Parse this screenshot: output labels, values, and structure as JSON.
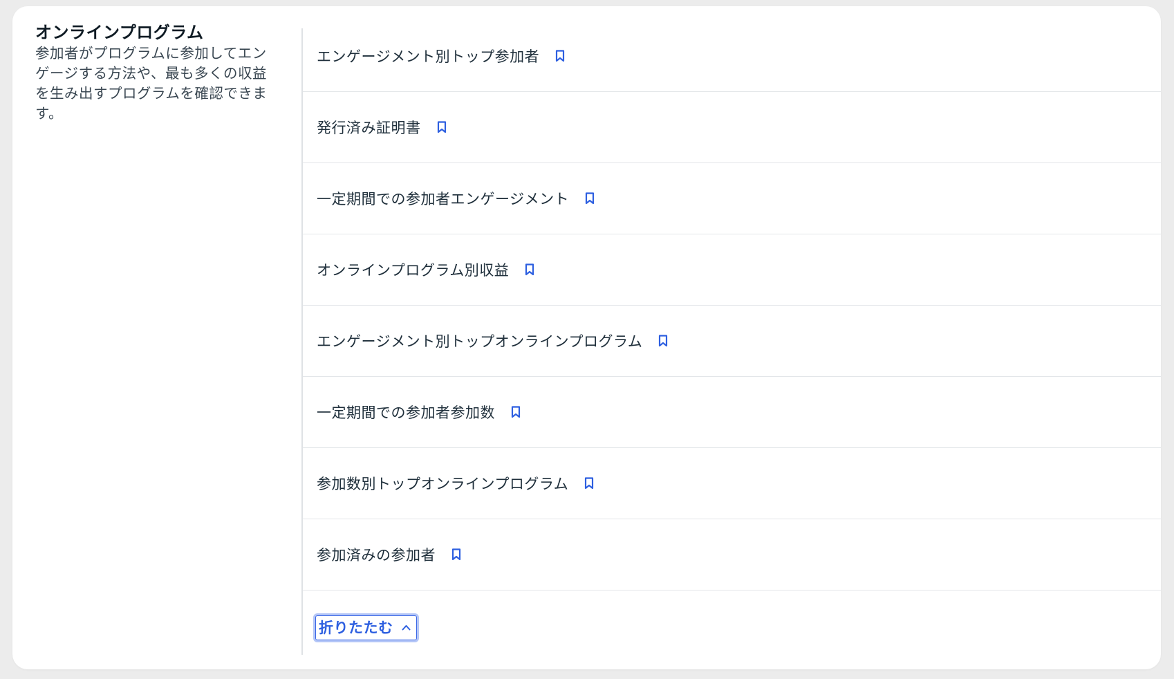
{
  "section": {
    "title": "オンラインプログラム",
    "description": "参加者がプログラムに参加してエンゲージする方法や、最も多くの収益を生み出すプログラムを確認できます。"
  },
  "reports": [
    {
      "label": "エンゲージメント別トップ参加者"
    },
    {
      "label": "発行済み証明書"
    },
    {
      "label": "一定期間での参加者エンゲージメント"
    },
    {
      "label": "オンラインプログラム別収益"
    },
    {
      "label": "エンゲージメント別トップオンラインプログラム"
    },
    {
      "label": "一定期間での参加者参加数"
    },
    {
      "label": "参加数別トップオンラインプログラム"
    },
    {
      "label": "参加済みの参加者"
    }
  ],
  "collapse": {
    "label": "折りたたむ",
    "icon": "chevron-up-icon"
  },
  "icons": {
    "bookmark": "bookmark-icon"
  },
  "colors": {
    "accent": "#2d5fe0",
    "background": "#ececec",
    "card": "#ffffff",
    "text": "#20303c"
  }
}
